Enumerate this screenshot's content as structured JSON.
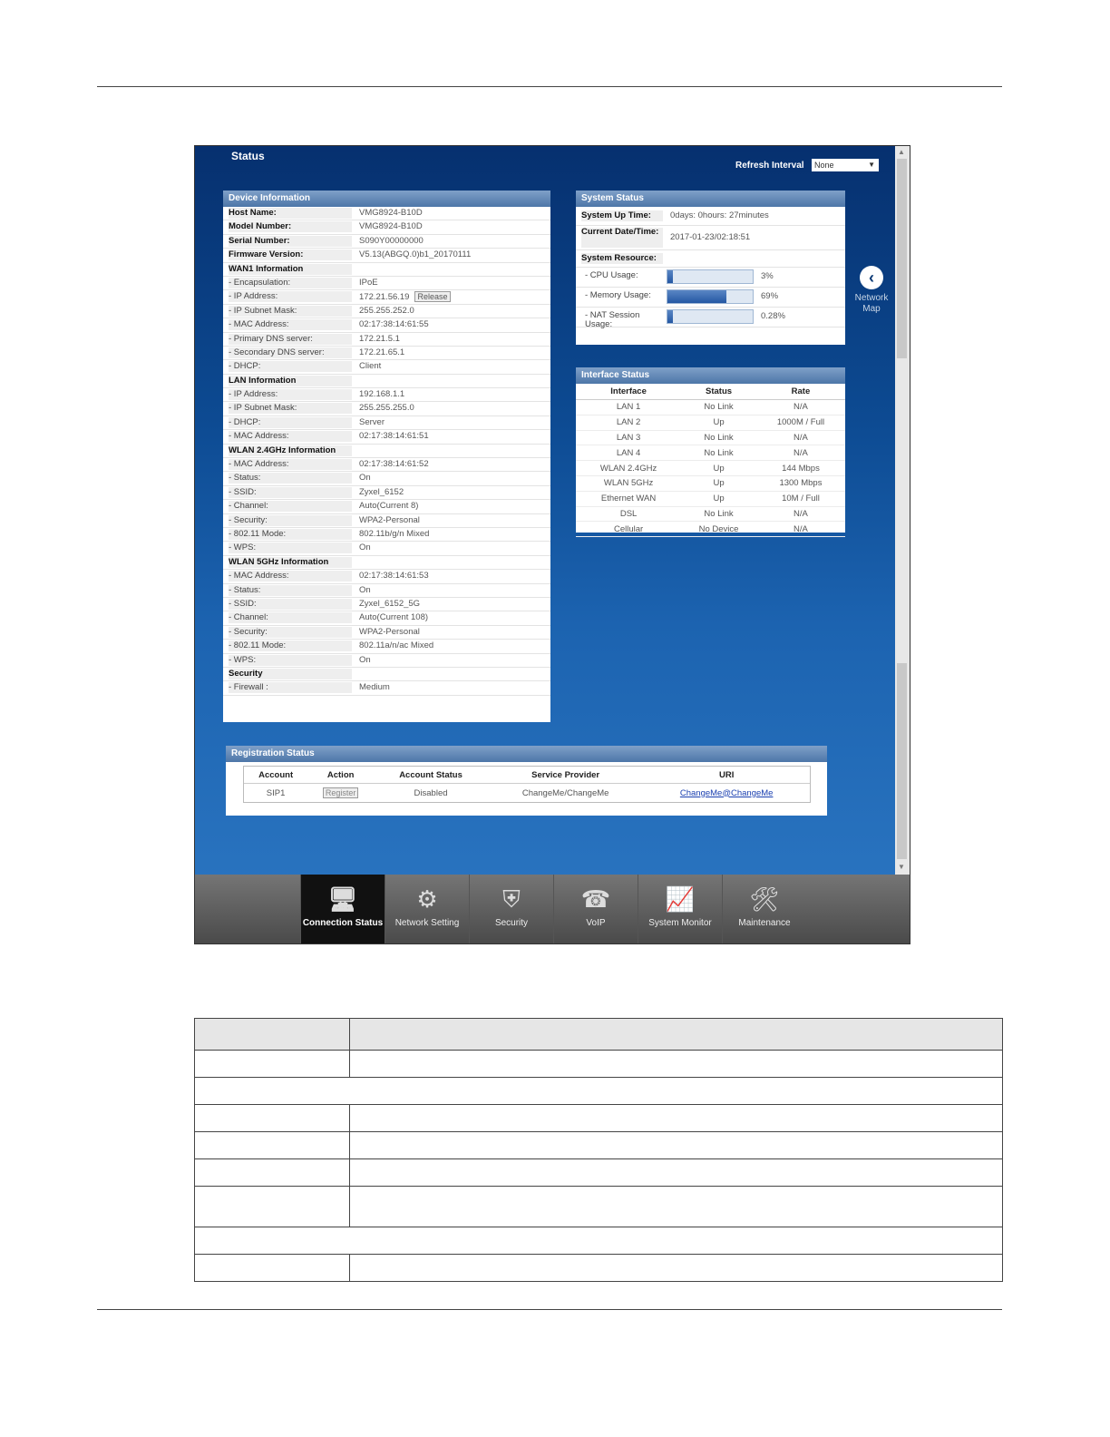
{
  "page": {
    "title": "Status"
  },
  "refresh": {
    "label": "Refresh Interval",
    "value": "None"
  },
  "device_info": {
    "title": "Device Information",
    "rows": [
      {
        "k": "Host Name:",
        "v": "VMG8924-B10D",
        "type": "b"
      },
      {
        "k": "Model Number:",
        "v": "VMG8924-B10D",
        "type": "b"
      },
      {
        "k": "Serial Number:",
        "v": "S090Y00000000",
        "type": "b"
      },
      {
        "k": "Firmware Version:",
        "v": "V5.13(ABGQ.0)b1_20170111",
        "type": "b"
      },
      {
        "k": "WAN1 Information",
        "v": "",
        "type": "sec"
      },
      {
        "k": "- Encapsulation:",
        "v": "IPoE"
      },
      {
        "k": "- IP Address:",
        "v": "172.21.56.19",
        "btn": "Release"
      },
      {
        "k": "- IP Subnet Mask:",
        "v": "255.255.252.0"
      },
      {
        "k": "- MAC Address:",
        "v": "02:17:38:14:61:55"
      },
      {
        "k": "- Primary DNS server:",
        "v": "172.21.5.1"
      },
      {
        "k": "- Secondary DNS server:",
        "v": "172.21.65.1"
      },
      {
        "k": "- DHCP:",
        "v": "Client"
      },
      {
        "k": "LAN Information",
        "v": "",
        "type": "sec"
      },
      {
        "k": "- IP Address:",
        "v": "192.168.1.1"
      },
      {
        "k": "- IP Subnet Mask:",
        "v": "255.255.255.0"
      },
      {
        "k": "- DHCP:",
        "v": "Server"
      },
      {
        "k": "- MAC Address:",
        "v": "02:17:38:14:61:51"
      },
      {
        "k": "WLAN 2.4GHz Information",
        "v": "",
        "type": "sec"
      },
      {
        "k": "- MAC Address:",
        "v": "02:17:38:14:61:52"
      },
      {
        "k": "- Status:",
        "v": "On"
      },
      {
        "k": "- SSID:",
        "v": "Zyxel_6152"
      },
      {
        "k": "- Channel:",
        "v": "Auto(Current 8)"
      },
      {
        "k": "- Security:",
        "v": "WPA2-Personal"
      },
      {
        "k": "- 802.11 Mode:",
        "v": "802.11b/g/n Mixed"
      },
      {
        "k": "- WPS:",
        "v": "On"
      },
      {
        "k": "WLAN 5GHz Information",
        "v": "",
        "type": "sec"
      },
      {
        "k": "- MAC Address:",
        "v": "02:17:38:14:61:53"
      },
      {
        "k": "- Status:",
        "v": "On"
      },
      {
        "k": "- SSID:",
        "v": "Zyxel_6152_5G"
      },
      {
        "k": "- Channel:",
        "v": "Auto(Current 108)"
      },
      {
        "k": "- Security:",
        "v": "WPA2-Personal"
      },
      {
        "k": "- 802.11 Mode:",
        "v": "802.11a/n/ac Mixed"
      },
      {
        "k": "- WPS:",
        "v": "On"
      },
      {
        "k": "Security",
        "v": "",
        "type": "sec"
      },
      {
        "k": "- Firewall :",
        "v": "Medium"
      }
    ]
  },
  "system_status": {
    "title": "System Status",
    "uptime_label": "System Up Time:",
    "uptime": "0days: 0hours: 27minutes",
    "datetime_label": "Current Date/Time:",
    "datetime": "2017-01-23/02:18:51",
    "resource_label": "System Resource:",
    "resources": [
      {
        "label": "- CPU Usage:",
        "value": "3%",
        "fraction": 0.03
      },
      {
        "label": "- Memory Usage:",
        "value": "69%",
        "fraction": 0.69
      },
      {
        "label": "- NAT Session Usage:",
        "value": "0.28%",
        "fraction": 0.03
      }
    ]
  },
  "interface_status": {
    "title": "Interface Status",
    "headers": [
      "Interface",
      "Status",
      "Rate"
    ],
    "rows": [
      [
        "LAN 1",
        "No Link",
        "N/A"
      ],
      [
        "LAN 2",
        "Up",
        "1000M / Full"
      ],
      [
        "LAN 3",
        "No Link",
        "N/A"
      ],
      [
        "LAN 4",
        "No Link",
        "N/A"
      ],
      [
        "WLAN 2.4GHz",
        "Up",
        "144 Mbps"
      ],
      [
        "WLAN 5GHz",
        "Up",
        "1300 Mbps"
      ],
      [
        "Ethernet WAN",
        "Up",
        "10M / Full"
      ],
      [
        "DSL",
        "No Link",
        "N/A"
      ],
      [
        "Cellular",
        "No Device",
        "N/A"
      ]
    ]
  },
  "registration": {
    "title": "Registration Status",
    "headers": [
      "Account",
      "Action",
      "Account Status",
      "Service Provider",
      "URI"
    ],
    "row": {
      "account": "SIP1",
      "action": "Register",
      "status": "Disabled",
      "provider": "ChangeMe/ChangeMe",
      "uri": "ChangeMe@ChangeMe"
    }
  },
  "network_map": {
    "label": "Network Map",
    "icon": "chevron-left-icon"
  },
  "toolbar": [
    {
      "label": "Connection Status",
      "icon": "monitor-globe-icon",
      "active": true
    },
    {
      "label": "Network Setting",
      "icon": "gear-icon"
    },
    {
      "label": "Security",
      "icon": "shield-icon"
    },
    {
      "label": "VoIP",
      "icon": "phone-icon"
    },
    {
      "label": "System Monitor",
      "icon": "chart-monitor-icon"
    },
    {
      "label": "Maintenance",
      "icon": "tools-icon"
    }
  ],
  "colors": {
    "accent": "#0d4b93",
    "panel_header": "#5a82b2",
    "link": "#1a3fb0"
  }
}
